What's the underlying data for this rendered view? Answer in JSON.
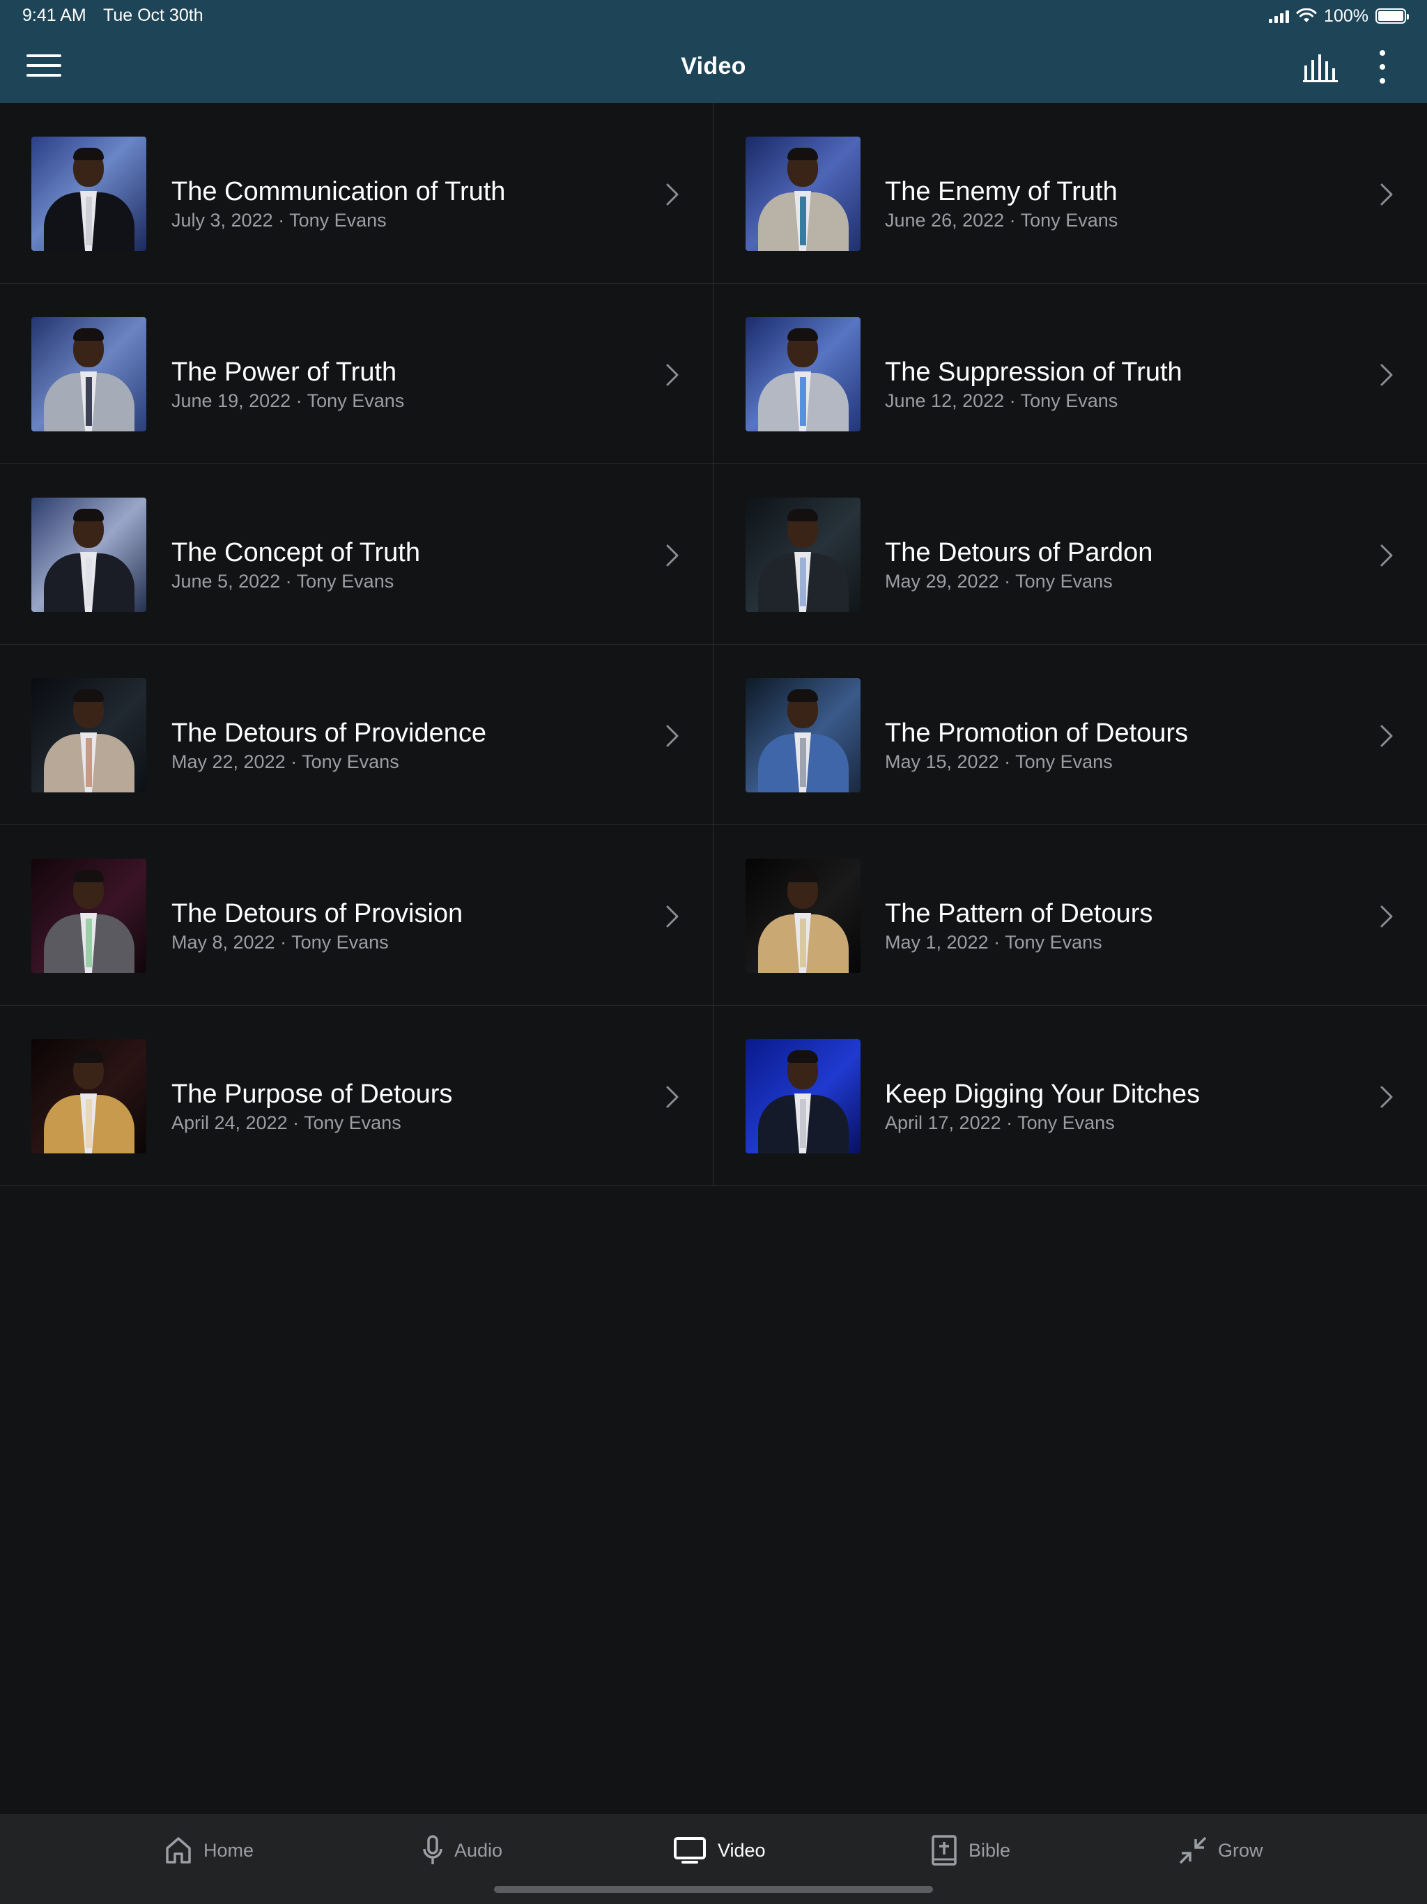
{
  "status_bar": {
    "time": "9:41 AM",
    "date": "Tue Oct 30th",
    "battery": "100%",
    "battery_level": 1.0
  },
  "header": {
    "title": "Video",
    "background": "#1e4557"
  },
  "videos": [
    {
      "title": "The Communication of Truth",
      "meta": "July 3, 2022 · Tony Evans"
    },
    {
      "title": "The Enemy of Truth",
      "meta": "June 26, 2022 · Tony Evans"
    },
    {
      "title": "The Power of Truth",
      "meta": "June 19, 2022 · Tony Evans"
    },
    {
      "title": "The Suppression of Truth",
      "meta": "June 12, 2022 · Tony Evans"
    },
    {
      "title": "The Concept of Truth",
      "meta": "June 5, 2022 · Tony Evans"
    },
    {
      "title": "The Detours of Pardon",
      "meta": "May 29, 2022 · Tony Evans"
    },
    {
      "title": "The Detours of Providence",
      "meta": "May 22, 2022 · Tony Evans"
    },
    {
      "title": "The Promotion of Detours",
      "meta": "May 15, 2022 · Tony Evans"
    },
    {
      "title": "The Detours of Provision",
      "meta": "May 8, 2022 · Tony Evans"
    },
    {
      "title": "The Pattern of Detours",
      "meta": "May 1, 2022 · Tony Evans"
    },
    {
      "title": "The Purpose of Detours",
      "meta": "April 24, 2022 · Tony Evans"
    },
    {
      "title": "Keep Digging Your Ditches",
      "meta": "April 17, 2022 · Tony Evans"
    }
  ],
  "tabs": [
    {
      "label": "Home",
      "icon": "home-icon"
    },
    {
      "label": "Audio",
      "icon": "microphone-icon"
    },
    {
      "label": "Video",
      "icon": "tv-icon",
      "active": true
    },
    {
      "label": "Bible",
      "icon": "bible-icon"
    },
    {
      "label": "Grow",
      "icon": "grow-icon"
    }
  ],
  "colors": {
    "background": "#121315",
    "tabbar": "#222325",
    "subtext": "#9b9ea3",
    "active_tab": "#ffffff"
  }
}
